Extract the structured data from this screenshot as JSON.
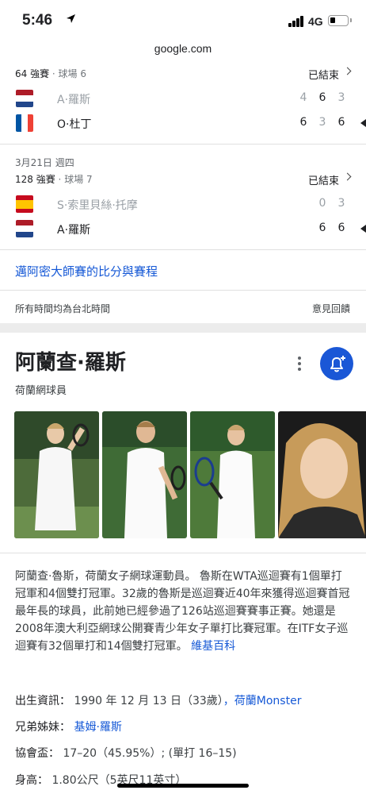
{
  "status_bar": {
    "time": "5:46",
    "network": "4G"
  },
  "url": "google.com",
  "matches": [
    {
      "date": "",
      "round": "64 強賽",
      "court": "球場 6",
      "status": "已結束",
      "players": [
        {
          "name": "A·羅斯",
          "flag": "nl",
          "scores": [
            "4",
            "6",
            "3"
          ],
          "winner": false
        },
        {
          "name": "O·杜丁",
          "flag": "fr",
          "scores": [
            "6",
            "3",
            "6"
          ],
          "winner": true
        }
      ]
    },
    {
      "date": "3月21日 週四",
      "round": "128 強賽",
      "court": "球場 7",
      "status": "已結束",
      "players": [
        {
          "name": "S·索里貝絲·托摩",
          "flag": "es",
          "scores": [
            "0",
            "3"
          ],
          "winner": false
        },
        {
          "name": "A·羅斯",
          "flag": "nl",
          "scores": [
            "6",
            "6"
          ],
          "winner": true
        }
      ]
    }
  ],
  "miami_link": "邁阿密大師賽的比分與賽程",
  "timezone_note": "所有時間均為台北時間",
  "feedback": "意見回饋",
  "knowledge_panel": {
    "title": "阿蘭查·羅斯",
    "subtitle": "荷蘭網球員",
    "description": "阿蘭查·魯斯，荷蘭女子網球運動員。 魯斯在WTA巡迴賽有1個單打冠軍和4個雙打冠軍。32歲的魯斯是巡迴賽近40年來獲得巡迴賽首冠最年長的球員，此前她已經參過了126站巡迴賽賽事正賽。她還是2008年澳大利亞網球公開賽青少年女子單打比賽冠軍。在ITF女子巡迴賽有32個單打和14個雙打冠軍。",
    "wiki_link": "維基百科",
    "facts": [
      {
        "label": "出生資訊：",
        "value": "1990 年 12 月 13 日（33歲）",
        "link": "，荷蘭Monster"
      },
      {
        "label": "兄弟姊妹：",
        "value": "",
        "link": "基姆·羅斯"
      },
      {
        "label": "協會盃：",
        "value": "17–20（45.95%）; (單打 16–15)",
        "link": ""
      },
      {
        "label": "身高：",
        "value": "1.80公尺（5英尺11英寸）",
        "link": ""
      }
    ]
  },
  "colors": {
    "accent": "#1a57d6",
    "link": "#1558d6"
  }
}
